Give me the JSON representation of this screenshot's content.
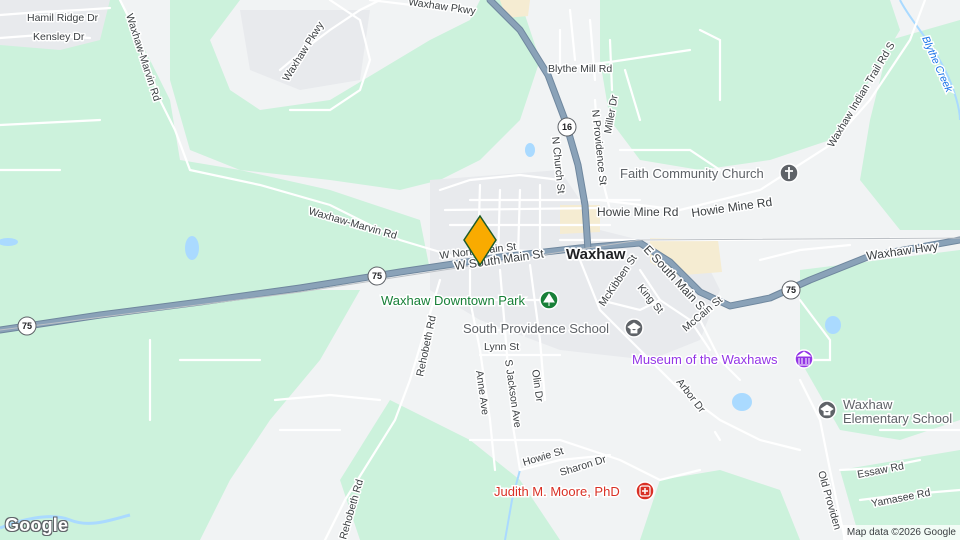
{
  "map": {
    "town": "Waxhaw",
    "roads": {
      "hamil_ridge_dr": "Hamil Ridge Dr",
      "kensley_dr": "Kensley Dr",
      "waxhaw_marvin_rd": "Waxhaw-Marvin Rd",
      "waxhaw_pkwy_top": "Waxhaw Pkwy",
      "waxhaw_pkwy_left": "Waxhaw Pkwy",
      "blythe_mill_rd": "Blythe Mill Rd",
      "n_church_st": "N Church St",
      "n_providence_st": "N Providence St",
      "miller_dr": "Miller Dr",
      "howie_mine_rd_1": "Howie Mine Rd",
      "howie_mine_rd_2": "Howie Mine Rd",
      "waxhaw_marvin_rd_2": "Waxhaw-Marvin Rd",
      "w_north_main_st": "W North Main St",
      "w_south_main_st": "W South Main St",
      "e_south_main_st": "E South Main St",
      "mckibben_st": "McKibben St",
      "king_st": "King St",
      "mccain_st": "McCain St",
      "waxhaw_hwy": "Waxhaw Hwy",
      "waxhaw_indian_trail_rd_s": "Waxhaw Indian Trail Rd S",
      "rehobeth_rd": "Rehobeth Rd",
      "rehobeth_rd_2": "Rehobeth Rd",
      "lynn_st": "Lynn St",
      "anne_ave": "Anne Ave",
      "s_jackson_ave": "S Jackson Ave",
      "olin_dr": "Olin Dr",
      "arbor_dr": "Arbor Dr",
      "howie_st": "Howie St",
      "sharon_dr": "Sharon Dr",
      "essaw_rd": "Essaw Rd",
      "yamasee_rd": "Yamasee Rd",
      "old_providence": "Old Providen"
    },
    "water": {
      "blythe_creek": "Blythe Creek"
    },
    "shields": {
      "nc16": "16",
      "nc75_left": "75",
      "nc75_mid": "75",
      "nc75_right": "75"
    },
    "pois": {
      "faith_community_church": "Faith Community Church",
      "waxhaw_downtown_park": "Waxhaw Downtown Park",
      "south_providence_school": "South Providence School",
      "museum_of_the_waxhaws": "Museum of the Waxhaws",
      "waxhaw_elementary_line1": "Waxhaw",
      "waxhaw_elementary_line2": "Elementary School",
      "judith_moore": "Judith M. Moore, PhD"
    },
    "colors": {
      "background": "#f1f3f4",
      "green_area": "#ccf2dc",
      "highway": "#8aa2b8",
      "water": "#aadaff",
      "pin": "#f9ab00",
      "poi_green": "#188038",
      "poi_purple": "#9334e6",
      "poi_red": "#d93025"
    },
    "logo": "Google",
    "attribution": "Map data ©2026 Google"
  }
}
